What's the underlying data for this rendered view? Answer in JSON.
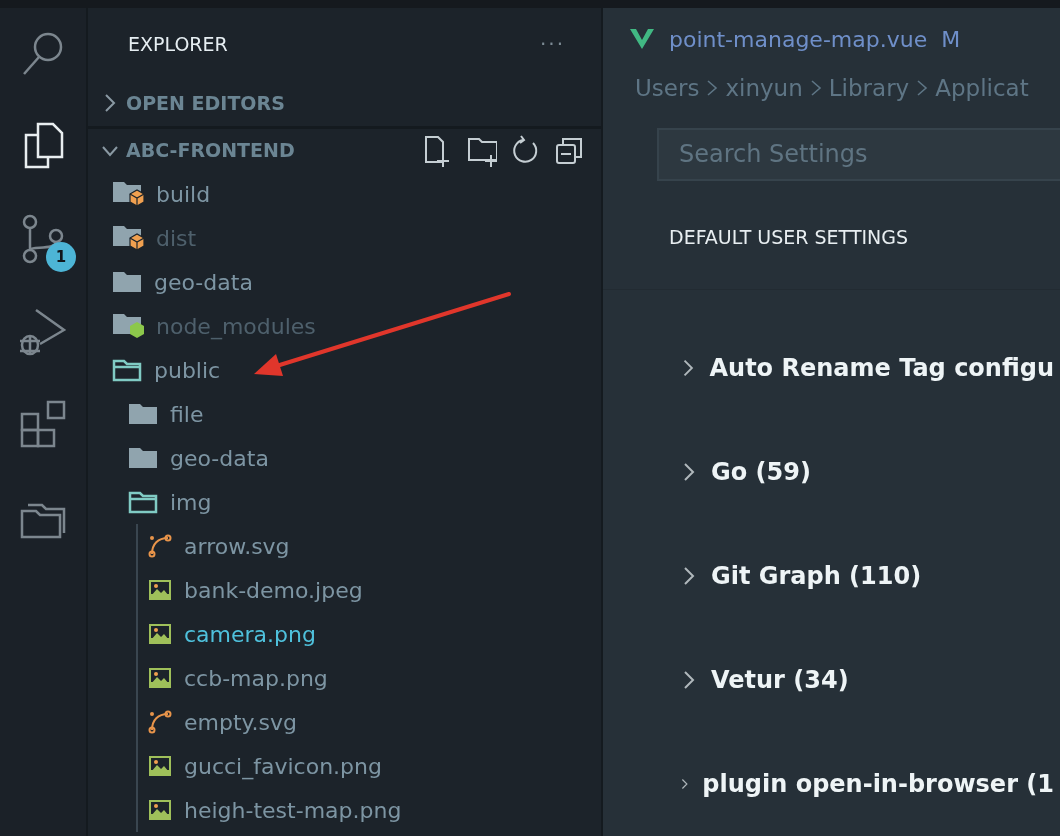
{
  "activity_bar": {
    "items": [
      {
        "kind": "search",
        "selected": false
      },
      {
        "kind": "files",
        "selected": true
      },
      {
        "kind": "source-control",
        "selected": false,
        "badge": "1"
      },
      {
        "kind": "run-debug",
        "selected": false
      },
      {
        "kind": "extensions",
        "selected": false
      },
      {
        "kind": "project-manager",
        "selected": false
      }
    ]
  },
  "sidebar": {
    "title": "EXPLORER",
    "more": "···",
    "sections": [
      {
        "title": "OPEN EDITORS",
        "expanded": false
      },
      {
        "title": "ABC-FRONTEND",
        "expanded": true
      }
    ],
    "tree": [
      {
        "label": "build",
        "kind": "folder-package",
        "expanded": false,
        "ignored": false,
        "highlighted": false
      },
      {
        "label": "dist",
        "kind": "folder-package",
        "expanded": false,
        "ignored": true,
        "highlighted": false
      },
      {
        "label": "geo-data",
        "kind": "folder",
        "expanded": false,
        "ignored": false,
        "highlighted": false
      },
      {
        "label": "node_modules",
        "kind": "folder-node",
        "expanded": false,
        "ignored": true,
        "highlighted": false
      },
      {
        "label": "public",
        "kind": "folder",
        "expanded": true,
        "ignored": false,
        "highlighted": false,
        "children": [
          {
            "label": "file",
            "kind": "folder",
            "expanded": false,
            "ignored": false,
            "highlighted": false
          },
          {
            "label": "geo-data",
            "kind": "folder",
            "expanded": false,
            "ignored": false,
            "highlighted": false
          },
          {
            "label": "img",
            "kind": "folder",
            "expanded": true,
            "ignored": false,
            "highlighted": false,
            "children": [
              {
                "label": "arrow.svg",
                "kind": "vector",
                "ignored": false,
                "highlighted": false
              },
              {
                "label": "bank-demo.jpeg",
                "kind": "image",
                "ignored": false,
                "highlighted": false
              },
              {
                "label": "camera.png",
                "kind": "image",
                "ignored": false,
                "highlighted": true
              },
              {
                "label": "ccb-map.png",
                "kind": "image",
                "ignored": false,
                "highlighted": false
              },
              {
                "label": "empty.svg",
                "kind": "vector",
                "ignored": false,
                "highlighted": false
              },
              {
                "label": "gucci_favicon.png",
                "kind": "image",
                "ignored": false,
                "highlighted": false
              },
              {
                "label": "heigh-test-map.png",
                "kind": "image",
                "ignored": false,
                "highlighted": false
              }
            ]
          }
        ]
      }
    ]
  },
  "editor": {
    "tab": {
      "label": "point-manage-map.vue",
      "status": "M"
    },
    "breadcrumbs": [
      "Users",
      "xinyun",
      "Library",
      "Applicat"
    ],
    "search": {
      "placeholder": "Search Settings"
    },
    "settings_tab": "DEFAULT USER SETTINGS",
    "groups": [
      {
        "label": "Auto Rename Tag configu",
        "expanded": false
      },
      {
        "label": "Go (59)",
        "expanded": false
      },
      {
        "label": "Git Graph (110)",
        "expanded": false
      },
      {
        "label": "Vetur (34)",
        "expanded": false
      },
      {
        "label": "plugin open-in-browser (1",
        "expanded": false
      }
    ]
  }
}
